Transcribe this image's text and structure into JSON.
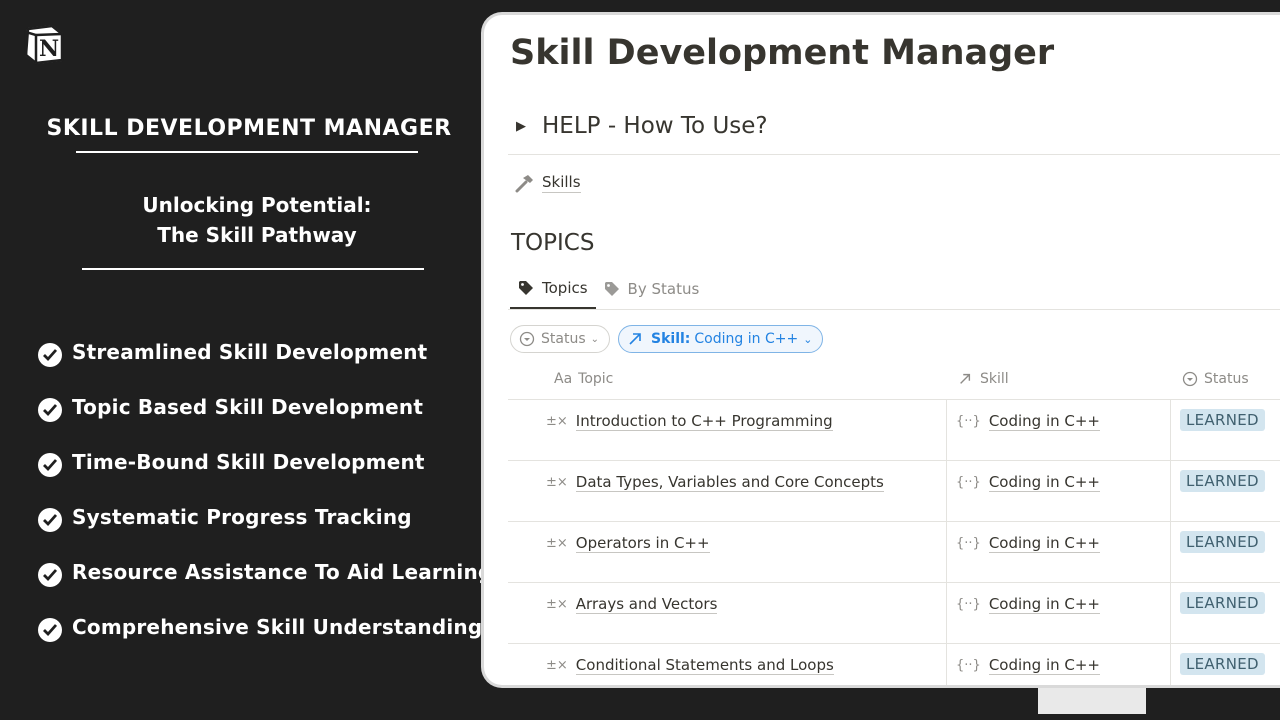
{
  "brand": {
    "logo_letter": "N",
    "title": "SKILL DEVELOPMENT MANAGER",
    "tagline_line1": "Unlocking Potential:",
    "tagline_line2": "The Skill Pathway"
  },
  "features": [
    "Streamlined Skill Development",
    "Topic Based Skill Development",
    "Time-Bound Skill Development",
    "Systematic Progress Tracking",
    "Resource Assistance To Aid Learning",
    "Comprehensive Skill Understanding"
  ],
  "app": {
    "page_title": "Skill Development Manager",
    "help_toggle": "HELP - How To Use?",
    "skills_link": "Skills",
    "section_heading": "TOPICS",
    "views": [
      "Topics",
      "By Status"
    ],
    "filters": {
      "status_label": "Status",
      "skill_label": "Skill:",
      "skill_value": "Coding in C++"
    },
    "columns": {
      "topic_prefix": "Aa",
      "topic": "Topic",
      "skill": "Skill",
      "status": "Status"
    },
    "rows": [
      {
        "topic": "Introduction to C++ Programming",
        "skill": "Coding in C++",
        "status": "LEARNED"
      },
      {
        "topic": "Data Types, Variables and Core Concepts",
        "skill": "Coding in C++",
        "status": "LEARNED"
      },
      {
        "topic": "Operators in C++",
        "skill": "Coding in C++",
        "status": "LEARNED"
      },
      {
        "topic": "Arrays and Vectors",
        "skill": "Coding in C++",
        "status": "LEARNED"
      },
      {
        "topic": "Conditional Statements and Loops",
        "skill": "Coding in C++",
        "status": "LEARNED"
      }
    ]
  },
  "colors": {
    "background": "#1f1f1f",
    "badge_bg": "#d3e5ef",
    "accent_blue": "#2383e2"
  }
}
